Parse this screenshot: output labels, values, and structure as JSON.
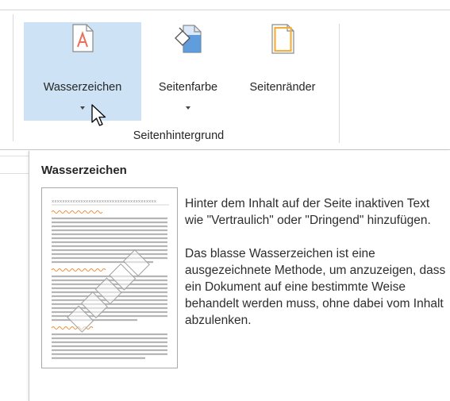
{
  "ribbon": {
    "buttons": [
      {
        "label": "Wasserzeichen",
        "icon": "watermark-page-icon",
        "has_dropdown": true,
        "active": true
      },
      {
        "label": "Seitenfarbe",
        "icon": "page-color-bucket-icon",
        "has_dropdown": true,
        "active": false
      },
      {
        "label": "Seitenränder",
        "icon": "page-borders-icon",
        "has_dropdown": false,
        "active": false
      }
    ],
    "group_label": "Seitenhintergrund"
  },
  "tooltip": {
    "title": "Wasserzeichen",
    "paragraphs": [
      "Hinter dem Inhalt auf der Seite inaktiven Text wie \"Vertraulich\" oder \"Dringend\" hinzufügen.",
      "Das blasse Wasserzeichen ist eine ausgezeichnete Methode, um anzuzeigen, dass ein Dokument auf eine bestimmte Weise behandelt werden muss, ohne dabei vom Inhalt abzulenken."
    ]
  },
  "colors": {
    "active_button_bg": "#cde3f5",
    "watermark_icon_accent": "#e8705a",
    "page_color_blue": "#4a8fd8",
    "page_border_orange": "#f0b040"
  }
}
